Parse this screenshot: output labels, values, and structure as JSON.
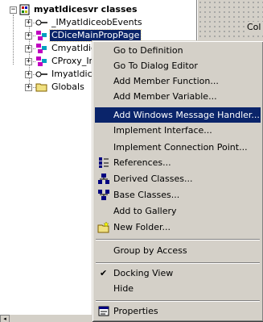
{
  "class_view": {
    "root": {
      "label": "myatldicesvr classes"
    },
    "items": [
      {
        "label": "_IMyatldiceobEvents",
        "kind": "interface"
      },
      {
        "label": "CDiceMainPropPage",
        "kind": "class",
        "selected": true
      },
      {
        "label": "Cmyatldic",
        "kind": "class"
      },
      {
        "label": "CProxy_Ir",
        "kind": "class"
      },
      {
        "label": "Imyatldice",
        "kind": "interface"
      },
      {
        "label": "Globals",
        "kind": "folder"
      }
    ]
  },
  "dialog_editor": {
    "partial_label": "Col"
  },
  "context_menu": {
    "items": [
      {
        "label": "Go to Definition",
        "type": "item"
      },
      {
        "label": "Go To Dialog Editor",
        "type": "item"
      },
      {
        "label": "Add Member Function...",
        "type": "item"
      },
      {
        "label": "Add Member Variable...",
        "type": "item"
      },
      {
        "label": "Add Windows Message Handler...",
        "type": "item",
        "highlighted": true
      },
      {
        "label": "Implement Interface...",
        "type": "item"
      },
      {
        "label": "Implement Connection Point...",
        "type": "item"
      },
      {
        "label": "References...",
        "type": "item",
        "icon": "references-icon"
      },
      {
        "label": "Derived Classes...",
        "type": "item",
        "icon": "derived-classes-icon"
      },
      {
        "label": "Base Classes...",
        "type": "item",
        "icon": "base-classes-icon"
      },
      {
        "label": "Add to Gallery",
        "type": "item"
      },
      {
        "label": "New Folder...",
        "type": "item",
        "icon": "new-folder-icon"
      },
      {
        "type": "separator"
      },
      {
        "label": "Group by Access",
        "type": "item"
      },
      {
        "type": "separator"
      },
      {
        "label": "Docking View",
        "type": "item",
        "checked": true
      },
      {
        "label": "Hide",
        "type": "item"
      },
      {
        "type": "separator"
      },
      {
        "label": "Properties",
        "type": "item",
        "icon": "properties-icon"
      }
    ]
  },
  "colors": {
    "selection": "#0a246a",
    "menu_face": "#d4d0c8",
    "highlight_text": "#ffffff"
  }
}
